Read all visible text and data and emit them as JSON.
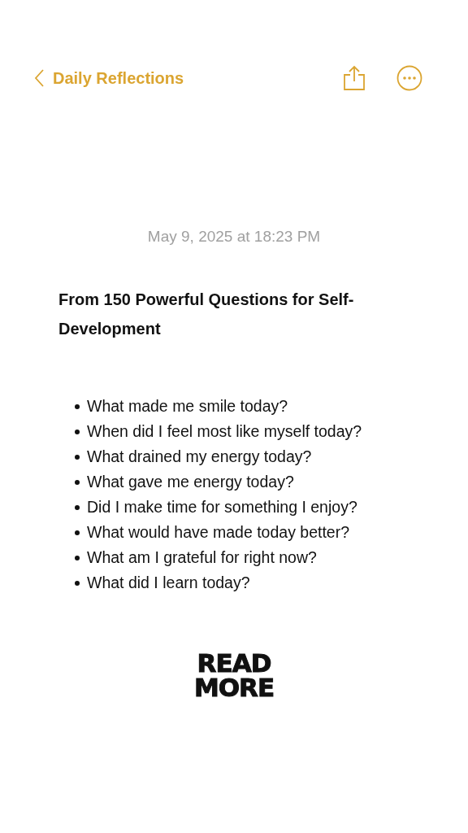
{
  "nav": {
    "back_label": "Daily Reflections"
  },
  "note": {
    "date": "May 9, 2025 at 18:23 PM",
    "title": "From 150 Powerful Questions for Self-Development",
    "items": [
      "What made me smile today?",
      "When did I feel most like myself today?",
      "What drained my energy today?",
      "What gave me energy today?",
      "Did I make time for something I enjoy?",
      "What would have made today better?",
      "What am I grateful for right now?",
      "What did I learn today?"
    ]
  },
  "logo": {
    "lines": [
      "READ",
      "MORE"
    ]
  }
}
